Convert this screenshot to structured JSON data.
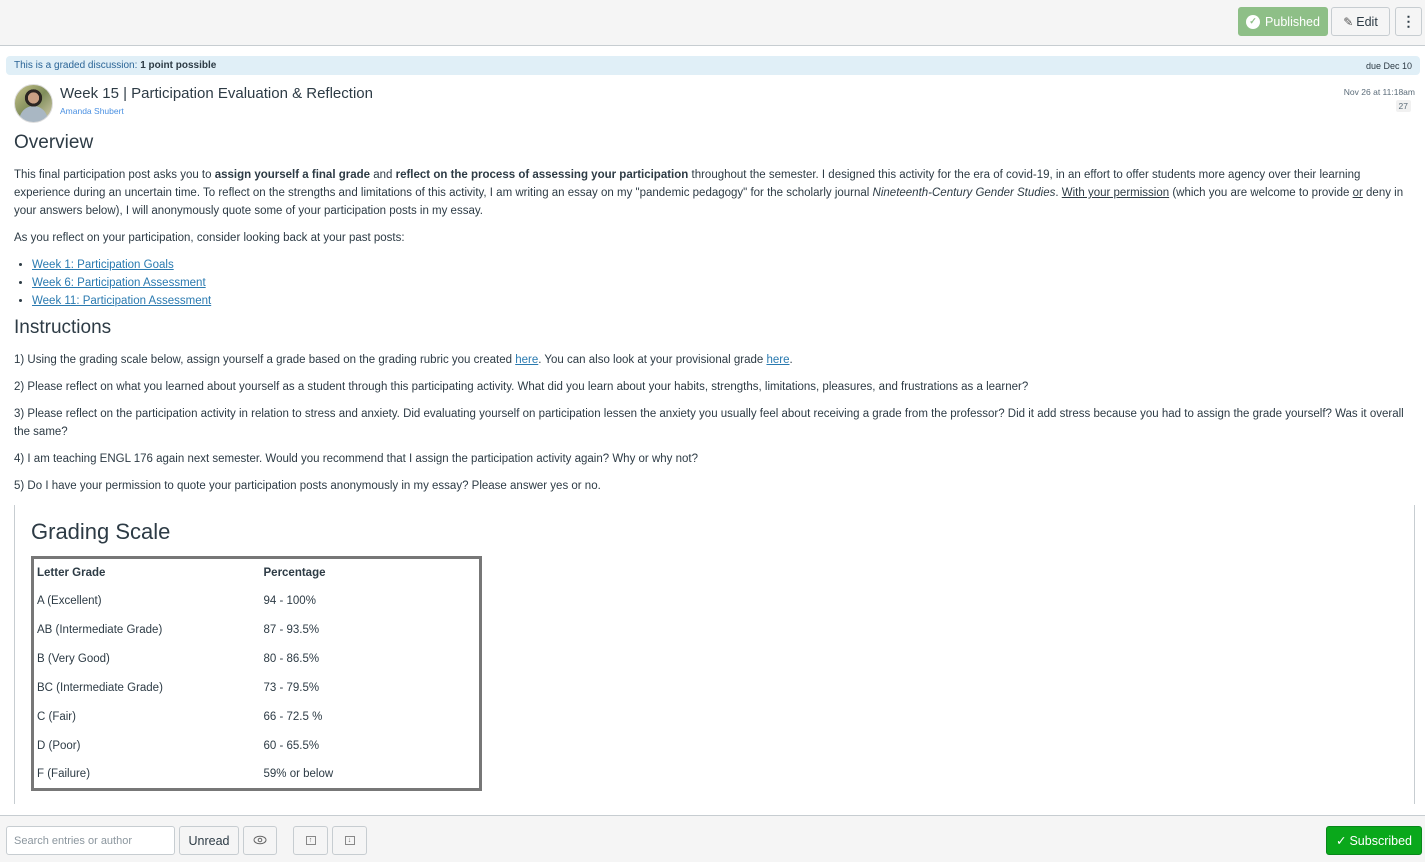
{
  "toolbar": {
    "published_label": "Published",
    "edit_label": "Edit",
    "more_label": "⋮"
  },
  "banner": {
    "graded_label": "This is a graded discussion:",
    "points": "1 point possible",
    "due": "due Dec 10"
  },
  "post": {
    "title": "Week 15 | Participation Evaluation & Reflection",
    "author": "Amanda Shubert",
    "date": "Nov 26 at 11:18am",
    "reply_count": "27"
  },
  "overview": {
    "heading": "Overview",
    "intro": {
      "t1": "This final participation post asks you to ",
      "b1": "assign yourself a final grade",
      "t2": " and ",
      "b2": "reflect on the process of assessing your participation",
      "t3": " throughout the semester. I designed this activity for the era of covid-19, in an effort to offer students more agency over their learning experience during an uncertain time. To reflect on the strengths and limitations of this activity, I am writing an essay on my \"pandemic pedagogy\" for the scholarly journal ",
      "i1": "Nineteenth-Century Gender Studies",
      "t4": ". ",
      "u1": "With your permission",
      "t5": " (which you are welcome to provide ",
      "u2": "or",
      "t6": " deny in your answers below), I will anonymously quote some of your participation posts in my essay."
    },
    "reflect_text": "As you reflect on your participation, consider looking back at your past posts:",
    "past_posts": [
      "Week 1: Participation Goals",
      "Week 6: Participation Assessment",
      "Week 11: Participation Assessment"
    ]
  },
  "instructions": {
    "heading": "Instructions",
    "q1_a": "1) Using the grading scale below, assign yourself a grade based on the grading rubric you created ",
    "q1_link1": "here",
    "q1_b": ". You can also look at your provisional grade ",
    "q1_link2": "here",
    "q1_c": ".",
    "q2": "2) Please reflect on what you learned about yourself as a student through this participating activity. What did you learn about your habits, strengths, limitations, pleasures, and frustrations as a learner?",
    "q3": "3) Please reflect on the participation activity in relation to stress and anxiety. Did evaluating yourself on participation lessen the anxiety you usually feel about receiving a grade from the professor? Did it add stress because you had to assign the grade yourself? Was it overall the same?",
    "q4": "4) I am teaching ENGL 176 again next semester. Would you recommend that I assign the participation activity again? Why or why not?",
    "q5": "5) Do I have your permission to quote your participation posts anonymously in my essay? Please answer yes or no."
  },
  "grading_scale": {
    "title": "Grading Scale",
    "headers": [
      "Letter Grade",
      "Percentage"
    ],
    "rows": [
      [
        "A (Excellent)",
        "94 - 100%"
      ],
      [
        "AB (Intermediate Grade)",
        "87 - 93.5%"
      ],
      [
        "B (Very Good)",
        "80 - 86.5%"
      ],
      [
        "BC (Intermediate Grade)",
        "73 - 79.5%"
      ],
      [
        "C (Fair)",
        "66 - 72.5 %"
      ],
      [
        "D (Poor)",
        "60 - 65.5%"
      ],
      [
        "F (Failure)",
        "59% or below"
      ]
    ]
  },
  "bottombar": {
    "search_placeholder": "Search entries or author",
    "unread_label": "Unread",
    "subscribed_label": "Subscribed"
  },
  "colors": {
    "published": "#8ebf87",
    "subscribed": "#0aa81b",
    "link": "#2a7ab0",
    "banner_bg": "#e0eff7"
  }
}
